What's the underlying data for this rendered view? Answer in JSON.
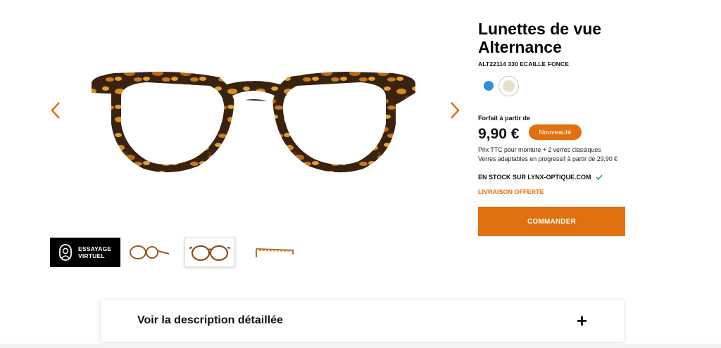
{
  "product": {
    "title_line1": "Lunettes de vue",
    "title_line2": "Alternance",
    "reference": "ALT22114 330 ECAILLE FONCE"
  },
  "gallery": {
    "virtual_tryon_line1": "ESSAYAGE",
    "virtual_tryon_line2": "VIRTUEL"
  },
  "colors": {
    "accent": "#e07010",
    "swatch_blue": "#2f8fd6",
    "swatch_beige": "#eadfc8"
  },
  "pricing": {
    "label": "Forfait à partir de",
    "price": "9,90 €",
    "badge": "Nouveauté",
    "note_line1": "Prix TTC pour monture + 2 verres classiques",
    "note_line2": "Verres adaptables en progressif à partir de 29,90 €"
  },
  "availability": {
    "stock": "EN STOCK SUR LYNX-OPTIQUE.COM",
    "delivery": "LIVRAISON OFFERTE"
  },
  "actions": {
    "order": "COMMANDER",
    "description": "Voir la description détaillée",
    "expand": "+"
  }
}
